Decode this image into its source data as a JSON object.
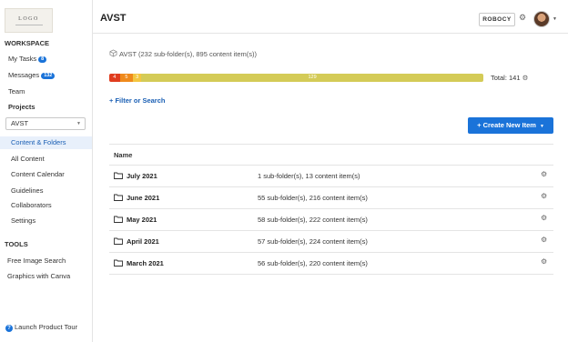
{
  "logo": {
    "text": "LOGO"
  },
  "sidebar": {
    "workspace_title": "WORKSPACE",
    "my_tasks": {
      "label": "My Tasks",
      "badge": "8"
    },
    "messages": {
      "label": "Messages",
      "badge": "132"
    },
    "team": "Team",
    "projects_title": "Projects",
    "project_select": "AVST",
    "items": [
      "Content & Folders",
      "All Content",
      "Content Calendar",
      "Guidelines",
      "Collaborators",
      "Settings"
    ],
    "active_item": "Content & Folders",
    "tools_title": "TOOLS",
    "tools": [
      "Free Image Search",
      "Graphics with Canva"
    ],
    "tour": "Launch Product Tour"
  },
  "header": {
    "title": "AVST",
    "account_button": "ROBOCY"
  },
  "main": {
    "breadcrumb_name": "AVST",
    "breadcrumb_detail": "(232 sub-folder(s), 895 content item(s))",
    "status_bar": {
      "segments": [
        {
          "label": "4",
          "value": 4,
          "color": "#e03c1e"
        },
        {
          "label": "5",
          "value": 5,
          "color": "#ef8a1c"
        },
        {
          "label": "3",
          "value": 3,
          "color": "#f3c640"
        },
        {
          "label": "129",
          "value": 129,
          "color": "#d4cb57"
        }
      ]
    },
    "total": "Total: 141",
    "filter_link": "+ Filter or Search",
    "create_button": "+ Create New Item",
    "table": {
      "header_name": "Name",
      "rows": [
        {
          "name": "July 2021",
          "desc": "1 sub-folder(s), 13 content item(s)"
        },
        {
          "name": "June 2021",
          "desc": "55 sub-folder(s), 216 content item(s)"
        },
        {
          "name": "May 2021",
          "desc": "58 sub-folder(s), 222 content item(s)"
        },
        {
          "name": "April 2021",
          "desc": "57 sub-folder(s), 224 content item(s)"
        },
        {
          "name": "March 2021",
          "desc": "56 sub-folder(s), 220 content item(s)"
        }
      ]
    }
  }
}
